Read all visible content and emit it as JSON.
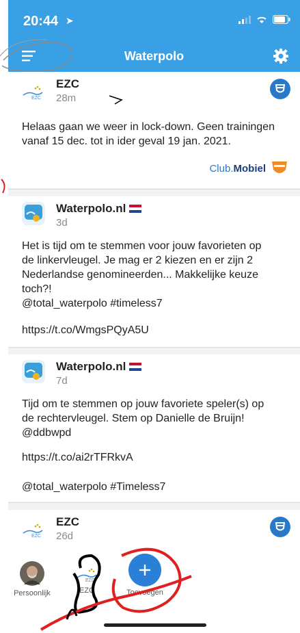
{
  "status_bar": {
    "time": "20:44"
  },
  "nav": {
    "title": "Waterpolo",
    "menu_icon": "hamburger-menu-icon",
    "settings_icon": "gear-icon"
  },
  "posts": [
    {
      "author": "EZC",
      "age": "28m",
      "text": "Helaas gaan we weer in lock-down. Geen trainingen vanaf 15 dec. tot in ider geval 19 jan. 2021.",
      "footer_brand_prefix": "Club.",
      "footer_brand_suffix": "Mobiel"
    },
    {
      "author": "Waterpolo.nl",
      "age": "3d",
      "text_lines": [
        "Het is tijd om te stemmen voor jouw favorieten op",
        "de linkervleugel. Je mag er 2 kiezen en er zijn 2",
        "Nederlandse genomineerden... Makkelijke keuze",
        "toch?!",
        "@total_waterpolo #timeless7"
      ],
      "link": "https://t.co/WmgsPQyA5U"
    },
    {
      "author": "Waterpolo.nl",
      "age": "7d",
      "text_lines": [
        "Tijd om te stemmen op jouw favoriete speler(s) op",
        "de rechtervleugel. Stem op Danielle de Bruijn!",
        "@ddbwpd"
      ],
      "link": "https://t.co/ai2rTFRkvA",
      "hashtags": "@total_waterpolo #Timeless7"
    },
    {
      "author": "EZC",
      "age": "26d"
    }
  ],
  "tabs": [
    {
      "label": "Persoonlijk"
    },
    {
      "label": "EZC"
    },
    {
      "label": "Toevoegen"
    }
  ],
  "colors": {
    "accent": "#3aa0e6",
    "fab": "#2a7fd6",
    "badge": "#2a78c8",
    "clubmobiel_orange": "#f08a24",
    "annotation_red": "#e02020"
  }
}
